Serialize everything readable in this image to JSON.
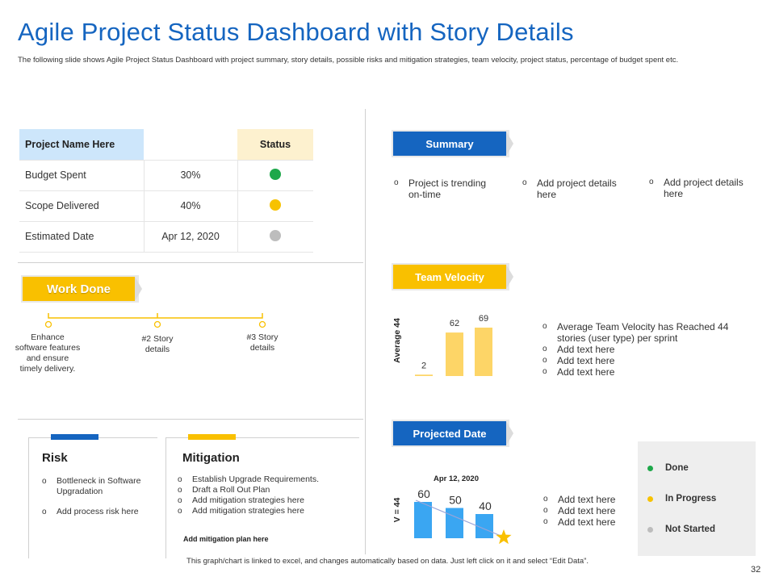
{
  "title": "Agile Project Status Dashboard with Story Details",
  "subtitle": "The following slide shows Agile Project Status Dashboard with project summary, story details, possible risks and mitigation strategies, team velocity, project status, percentage of budget spent etc.",
  "project_table": {
    "header": {
      "name": "Project Name Here",
      "status": "Status"
    },
    "rows": [
      {
        "label": "Budget Spent",
        "value": "30%",
        "status_color": "#1ea84a"
      },
      {
        "label": "Scope Delivered",
        "value": "40%",
        "status_color": "#f7c200"
      },
      {
        "label": "Estimated Date",
        "value": "Apr 12, 2020",
        "status_color": "#bdbdbd"
      }
    ]
  },
  "work_done": {
    "label": "Work Done",
    "items": [
      "Enhance software features and ensure timely delivery.",
      "#2 Story details",
      "#3 Story details"
    ]
  },
  "risk": {
    "title": "Risk",
    "items": [
      "Bottleneck in Software Upgradation",
      "Add process risk here"
    ]
  },
  "mitigation": {
    "title": "Mitigation",
    "items": [
      "Establish Upgrade Requirements.",
      "Draft a Roll Out Plan",
      "Add  mitigation strategies here",
      "Add  mitigation strategies here"
    ],
    "plan": "Add  mitigation plan here"
  },
  "summary": {
    "label": "Summary",
    "items": [
      "Project is trending on-time",
      "Add project details here",
      "Add project details here"
    ]
  },
  "team_velocity": {
    "label": "Team Velocity",
    "bullets": [
      "Average Team Velocity has Reached 44 stories (user type) per sprint",
      "Add text here",
      "Add text here",
      "Add text here"
    ]
  },
  "projected_date": {
    "label": "Projected Date",
    "bullets": [
      "Add text here",
      "Add text here",
      "Add text here"
    ]
  },
  "legend": {
    "items": [
      {
        "label": "Done",
        "color": "#1ea84a"
      },
      {
        "label": "In Progress",
        "color": "#f7c200"
      },
      {
        "label": "Not Started",
        "color": "#bdbdbd"
      }
    ]
  },
  "bullet_marker": "o",
  "chart_data": [
    {
      "type": "bar",
      "ylabel": "Average 44",
      "values": [
        2,
        62,
        69
      ],
      "data_labels": [
        "2",
        "62",
        "69"
      ],
      "color": "#fdd567"
    },
    {
      "type": "bar",
      "title": "Apr 12, 2020",
      "ylabel": "V = 44",
      "values": [
        60,
        50,
        40
      ],
      "data_labels": [
        "60",
        "50",
        "40"
      ],
      "color": "#3aa6f2",
      "trend_color": "#9aa4d8",
      "marker_color": "#f9c000"
    }
  ],
  "footer": "This graph/chart is linked to excel, and changes automatically based on data. Just left click on it and select “Edit Data”.",
  "page_number": "32"
}
